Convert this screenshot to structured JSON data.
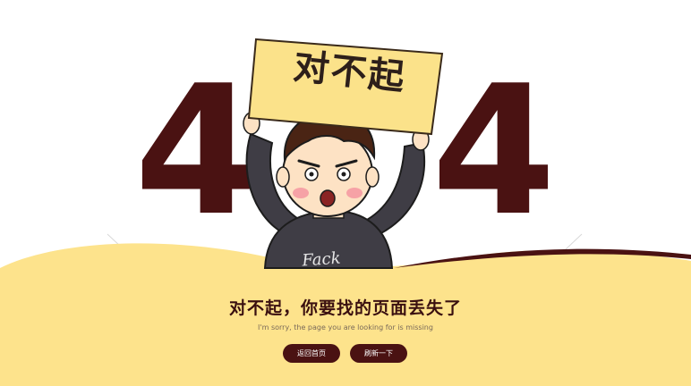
{
  "error": {
    "code_left": "4",
    "code_right": "4",
    "sign_text": "对不起",
    "shirt_text": "Fack",
    "title": "对不起，你要找的页面丢失了",
    "subtitle": "I'm sorry, the page you are looking for is missing"
  },
  "actions": {
    "home_label": "返回首页",
    "refresh_label": "刷新一下"
  },
  "colors": {
    "accent": "#4a1212",
    "sign_yellow": "#fbe28a",
    "ground_yellow": "#fde38c",
    "shirt": "#3f3d45",
    "hair": "#4a2414",
    "skin": "#fde2c4"
  }
}
